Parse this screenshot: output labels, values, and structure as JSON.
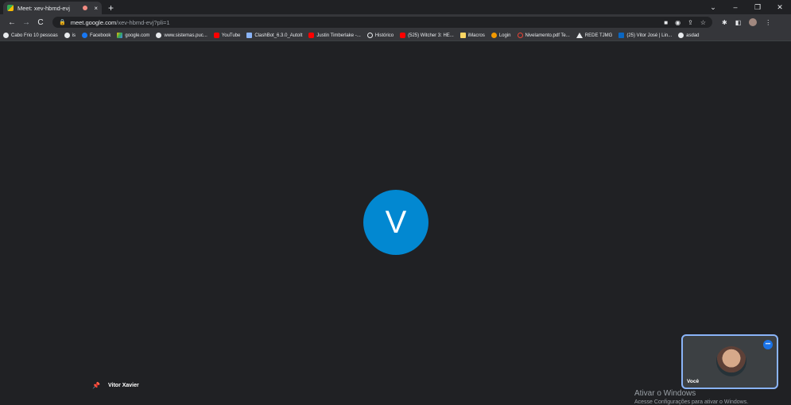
{
  "browser": {
    "tab": {
      "title": "Meet: xev-hbmd-evj",
      "close": "×"
    },
    "new_tab": "+",
    "window_controls": [
      "⌄",
      "–",
      "❐",
      "✕"
    ],
    "nav": {
      "back": "←",
      "forward": "→",
      "reload": "C"
    },
    "url": {
      "host": "meet.google.com",
      "path": "/xev-hbmd-evj?pli=1"
    },
    "omnibox_icons": [
      "camera-icon",
      "google-lens-icon",
      "share-icon",
      "star-icon"
    ],
    "toolbar_icons": [
      "extensions-icon",
      "sidepanel-icon",
      "profile-avatar",
      "menu-icon"
    ]
  },
  "bookmarks": [
    {
      "label": "Cabo Frio 10 pessoas",
      "icon": "globe"
    },
    {
      "label": "is",
      "icon": "globe"
    },
    {
      "label": "Facebook",
      "icon": "fb"
    },
    {
      "label": "google.com",
      "icon": "drive"
    },
    {
      "label": "www.sistemas.puc...",
      "icon": "globe"
    },
    {
      "label": "YouTube",
      "icon": "yt"
    },
    {
      "label": "ClashBot_6.3.0_AutoIt",
      "icon": "bot"
    },
    {
      "label": "Justin Timberlake -...",
      "icon": "yt"
    },
    {
      "label": "Histórico",
      "icon": "hist"
    },
    {
      "label": "(525) Witcher 3: HE...",
      "icon": "yt"
    },
    {
      "label": "iMacros",
      "icon": "note"
    },
    {
      "label": "Login",
      "icon": "login"
    },
    {
      "label": "Nivelamento.pdf Te...",
      "icon": "pdf"
    },
    {
      "label": "REDE TJMG",
      "icon": "tri"
    },
    {
      "label": "(25) Vitor José | Lin...",
      "icon": "in"
    },
    {
      "label": "asdad",
      "icon": "black"
    }
  ],
  "meeting": {
    "main_participant_initial": "V",
    "main_participant_color": "#0288d1",
    "pinned_name": "Vitor Xavier",
    "self_label": "Você",
    "self_audio_indicator": "•••"
  },
  "os_watermark": {
    "line1": "Ativar o Windows",
    "line2": "Acesse Configurações para ativar o Windows."
  }
}
